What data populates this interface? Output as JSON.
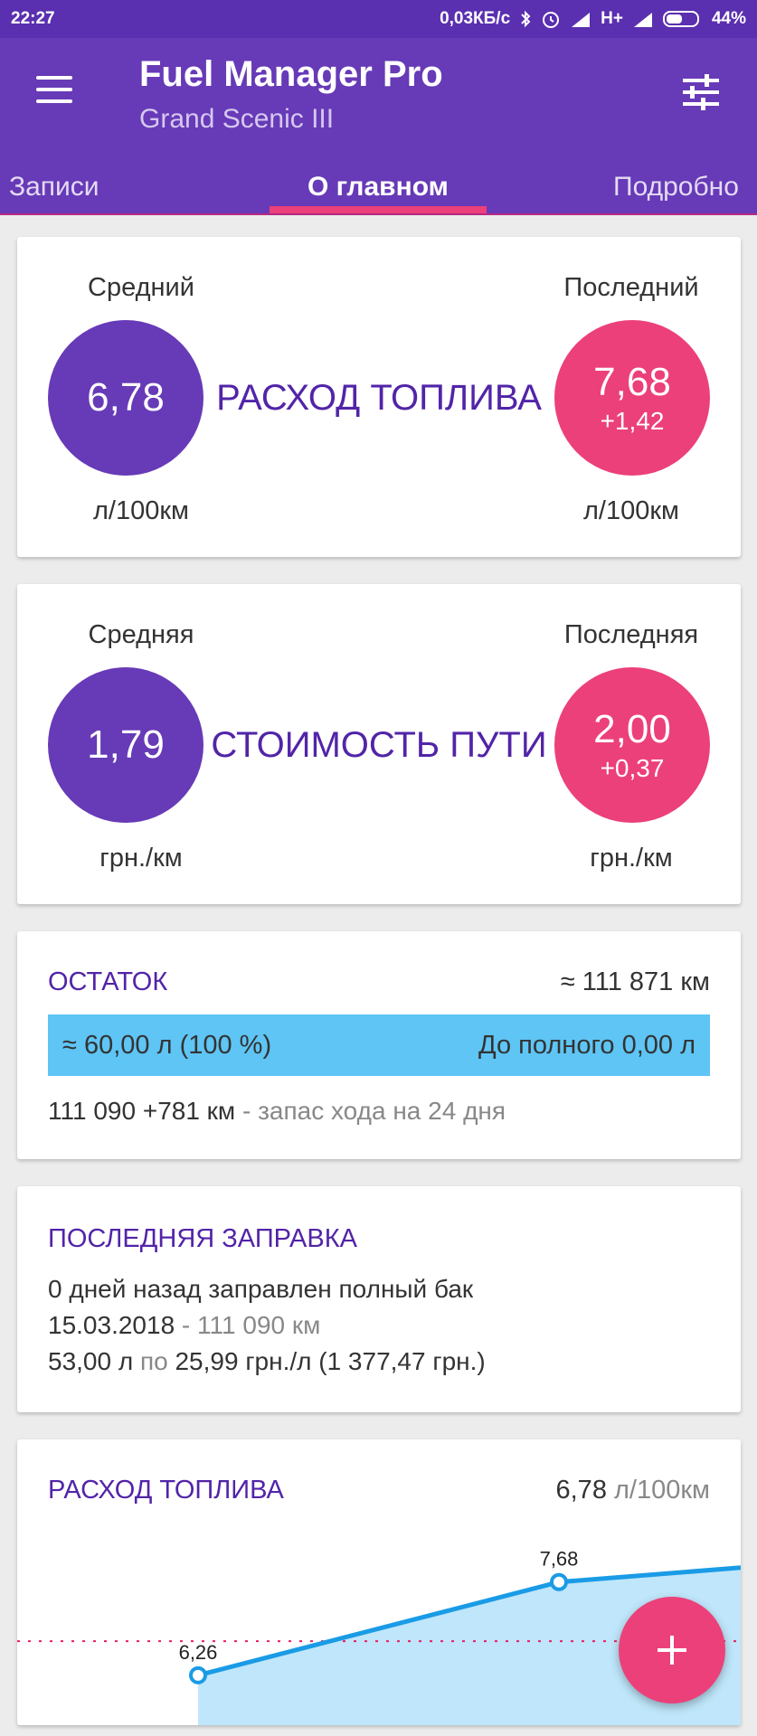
{
  "status_bar": {
    "time": "22:27",
    "network_speed": "0,03КБ/с",
    "network_type": "H+",
    "battery": "44%",
    "icons": [
      "bluetooth-icon",
      "alarm-icon",
      "signal-icon",
      "battery-icon"
    ]
  },
  "app_bar": {
    "title": "Fuel Manager Pro",
    "subtitle": "Grand Scenic III",
    "tabs": [
      {
        "label": "Записи",
        "active": false
      },
      {
        "label": "О главном",
        "active": true
      },
      {
        "label": "Подробно",
        "active": false
      }
    ]
  },
  "consumption": {
    "avg_label": "Средний",
    "last_label": "Последний",
    "avg_value": "6,78",
    "last_value": "7,68",
    "last_delta": "+1,42",
    "center_label": "РАСХОД ТОПЛИВА",
    "unit": "л/100км"
  },
  "cost": {
    "avg_label": "Средняя",
    "last_label": "Последняя",
    "avg_value": "1,79",
    "last_value": "2,00",
    "last_delta": "+0,37",
    "center_label": "СТОИМОСТЬ ПУТИ",
    "unit": "грн./км"
  },
  "remaining": {
    "title": "ОСТАТОК",
    "range": "≈ 111 871 км",
    "fuel": "≈ 60,00 л (100 %)",
    "to_full": "До полного 0,00 л",
    "odometer": "111 090 +781 км",
    "reserve": " - запас хода на 24 дня",
    "fill_percent": 100
  },
  "last_refuel": {
    "title": "ПОСЛЕДНЯЯ ЗАПРАВКА",
    "line1": "0 дней назад заправлен полный бак",
    "date": "15.03.2018",
    "date_sep": " - ",
    "odometer": "111 090 км",
    "volume": "53,00 л",
    "price_word": " по ",
    "price": "25,99 грн./л (1 377,47 грн.)"
  },
  "chart_card": {
    "title": "РАСХОД ТОПЛИВА",
    "value": "6,78",
    "unit": " л/100км"
  },
  "chart_data": {
    "type": "line",
    "x": [
      1,
      2,
      3
    ],
    "values": [
      6.26,
      7.68,
      7.9
    ],
    "point_labels": [
      "6,26",
      "7,68",
      ""
    ],
    "average": 6.78,
    "average_line": "dotted",
    "colors": {
      "line": "#1a9be6",
      "fill": "#bfe6fa",
      "average": "#e91e63"
    }
  },
  "fab": {
    "icon": "plus-icon"
  },
  "colors": {
    "primary": "#673ab7",
    "accent": "#ec407a",
    "fuel_bar": "#5ec5f5",
    "text_purple": "#5224a8"
  }
}
